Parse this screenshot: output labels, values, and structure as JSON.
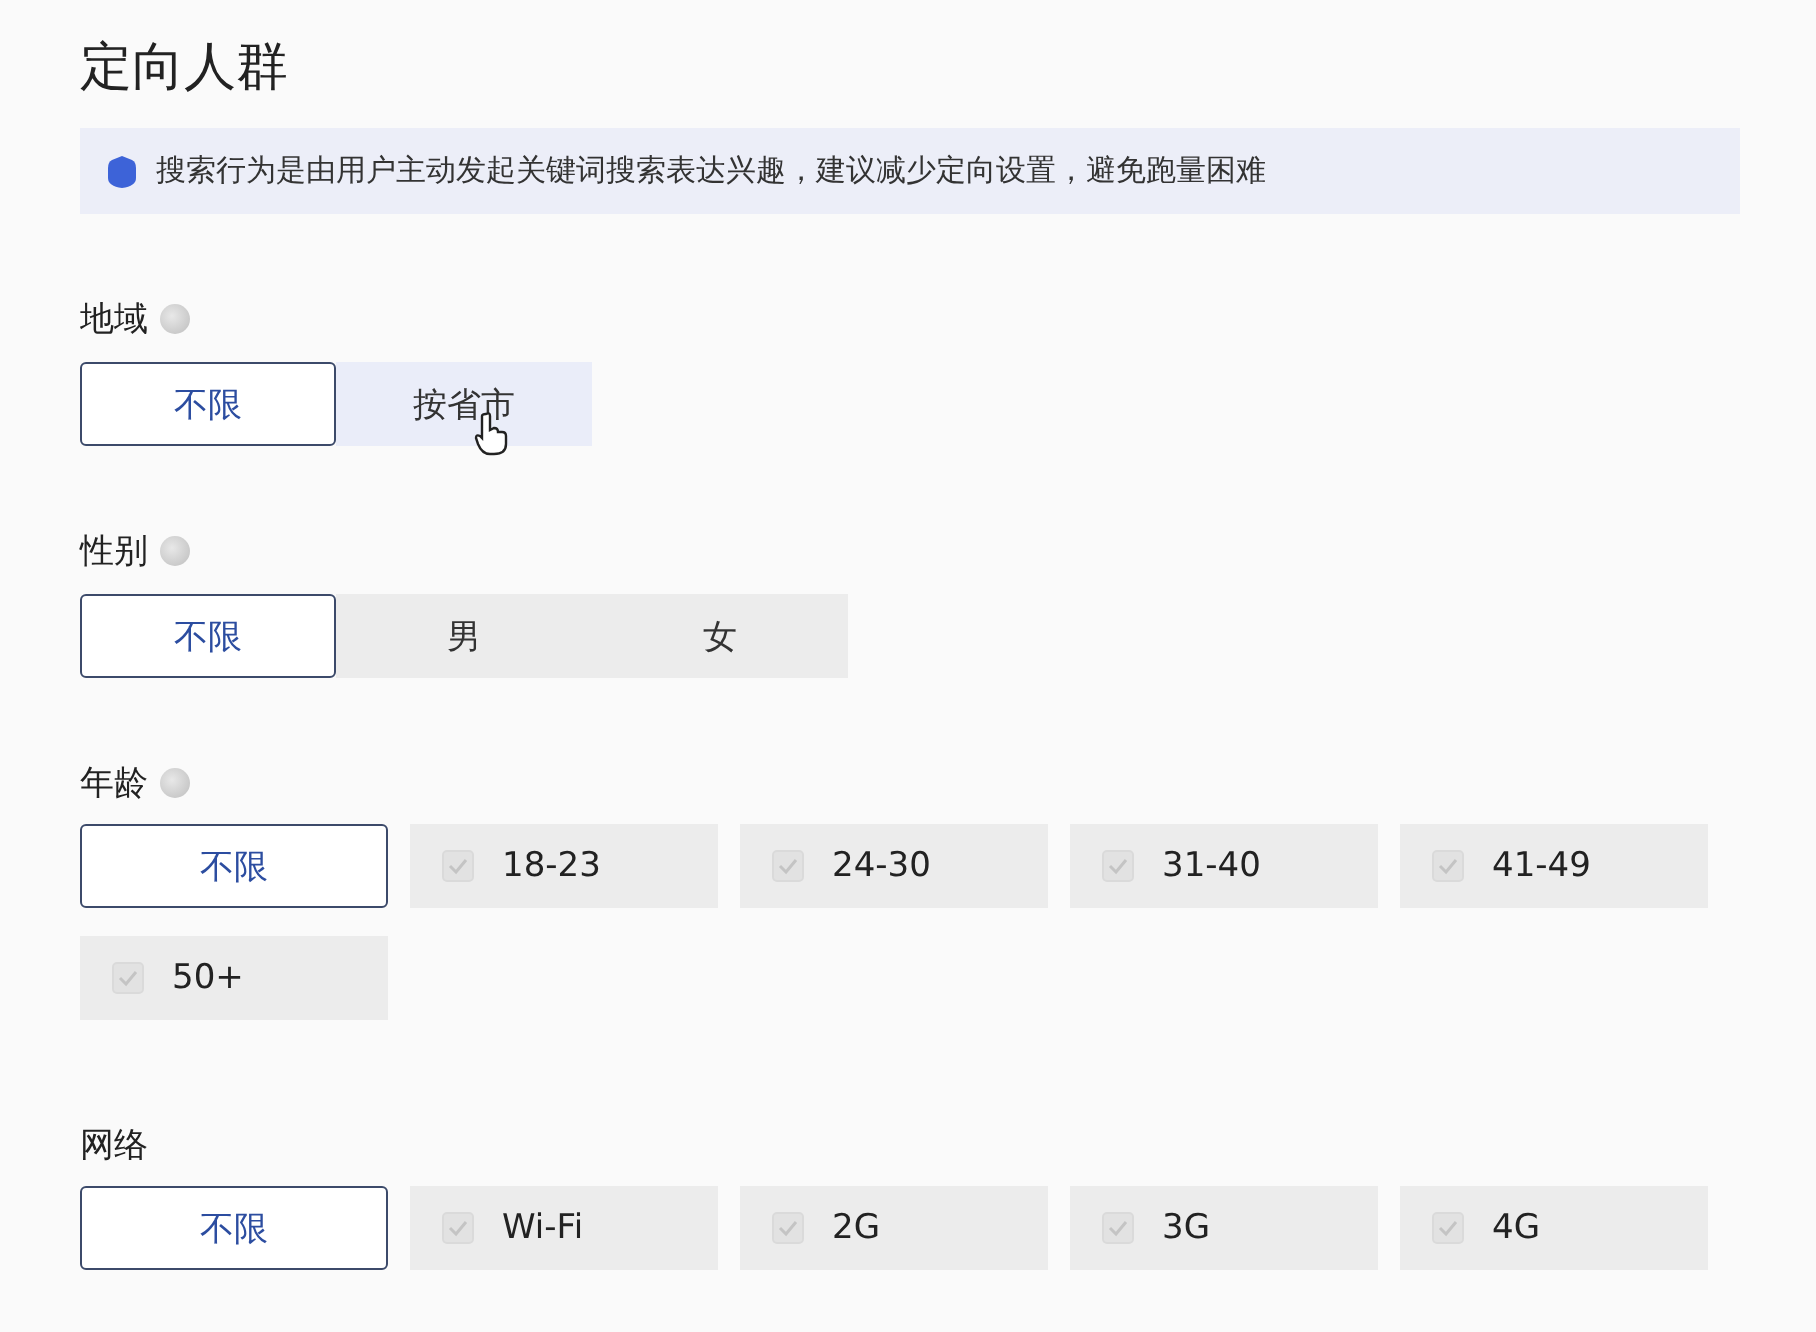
{
  "title": "定向人群",
  "notice": {
    "text": "搜索行为是由用户主动发起关键词搜索表达兴趣，建议减少定向设置，避免跑量困难"
  },
  "sections": [
    {
      "label": "地域",
      "help": true,
      "kind": "segment",
      "options": [
        {
          "label": "不限",
          "selected": true,
          "hovered": false
        },
        {
          "label": "按省市",
          "selected": false,
          "hovered": true
        }
      ]
    },
    {
      "label": "性别",
      "help": true,
      "kind": "segment",
      "options": [
        {
          "label": "不限",
          "selected": true,
          "hovered": false
        },
        {
          "label": "男",
          "selected": false,
          "hovered": false
        },
        {
          "label": "女",
          "selected": false,
          "hovered": false
        }
      ]
    },
    {
      "label": "年龄",
      "help": true,
      "kind": "checkbox",
      "any": {
        "label": "不限",
        "selected": true
      },
      "options": [
        {
          "label": "18-23",
          "checked": false
        },
        {
          "label": "24-30",
          "checked": false
        },
        {
          "label": "31-40",
          "checked": false
        },
        {
          "label": "41-49",
          "checked": false
        },
        {
          "label": "50+",
          "checked": false
        }
      ]
    },
    {
      "label": "网络",
      "help": false,
      "kind": "checkbox",
      "any": {
        "label": "不限",
        "selected": true
      },
      "options": [
        {
          "label": "Wi-Fi",
          "checked": false
        },
        {
          "label": "2G",
          "checked": false
        },
        {
          "label": "3G",
          "checked": false
        },
        {
          "label": "4G",
          "checked": false
        }
      ]
    }
  ]
}
